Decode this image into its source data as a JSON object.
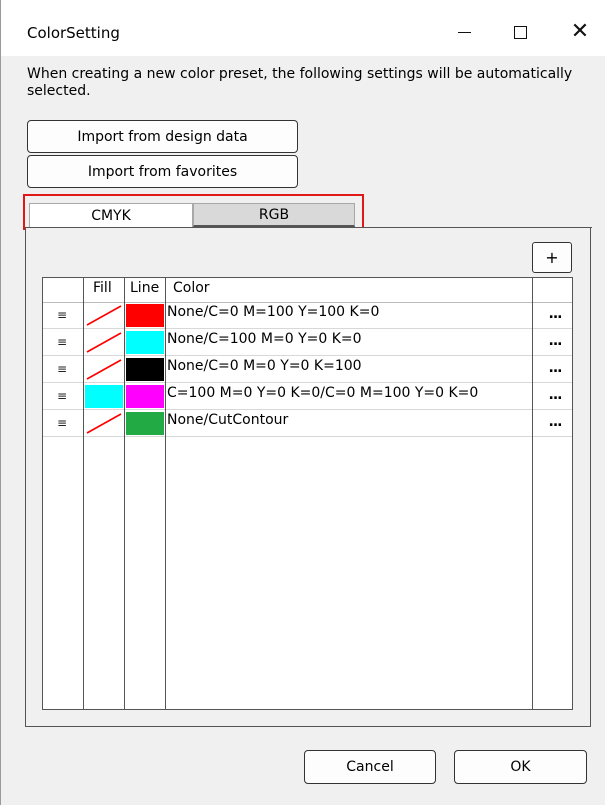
{
  "window": {
    "title": "ColorSetting",
    "controls": {
      "minimize": "minimize-icon",
      "maximize": "maximize-icon",
      "close": "close-icon"
    }
  },
  "description": "When creating a new color preset, the following settings will be automatically selected.",
  "buttons": {
    "import_design": "Import from design data",
    "import_favorites": "Import from favorites",
    "add": "+",
    "cancel": "Cancel",
    "ok": "OK"
  },
  "tabs": [
    {
      "label": "CMYK",
      "selected": false
    },
    {
      "label": "RGB",
      "selected": true
    }
  ],
  "table": {
    "headers": {
      "drag": "",
      "fill": "Fill",
      "line": "Line",
      "color": "Color",
      "action": ""
    },
    "rows": [
      {
        "drag": "≡",
        "fill": "none",
        "line": "#ff0000",
        "color": "None/C=0 M=100 Y=100 K=0",
        "action": "..."
      },
      {
        "drag": "≡",
        "fill": "none",
        "line": "#00ffff",
        "color": "None/C=100 M=0 Y=0 K=0",
        "action": "..."
      },
      {
        "drag": "≡",
        "fill": "none",
        "line": "#000000",
        "color": "None/C=0 M=0 Y=0 K=100",
        "action": "..."
      },
      {
        "drag": "≡",
        "fill": "#00ffff",
        "line": "#ff00ff",
        "color": "C=100 M=0 Y=0 K=0/C=0 M=100 Y=0 K=0",
        "action": "..."
      },
      {
        "drag": "≡",
        "fill": "none",
        "line": "#22aa44",
        "color": "None/CutContour",
        "action": "..."
      }
    ]
  },
  "colors": {
    "highlight_border": "#e01818",
    "none_slash": "#ff0000"
  }
}
